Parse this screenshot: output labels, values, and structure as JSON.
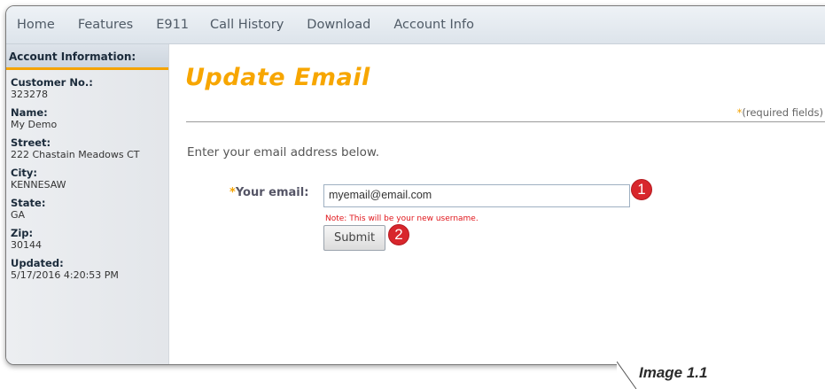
{
  "nav": {
    "items": [
      "Home",
      "Features",
      "E911",
      "Call History",
      "Download",
      "Account Info"
    ]
  },
  "sidebar": {
    "header": "Account Information:",
    "fields": [
      {
        "label": "Customer No.:",
        "value": "323278"
      },
      {
        "label": "Name:",
        "value": "My Demo"
      },
      {
        "label": "Street:",
        "value": "222 Chastain Meadows CT"
      },
      {
        "label": "City:",
        "value": "KENNESAW"
      },
      {
        "label": "State:",
        "value": "GA"
      },
      {
        "label": "Zip:",
        "value": "30144"
      },
      {
        "label": "Updated:",
        "value": "5/17/2016 4:20:53 PM"
      }
    ]
  },
  "main": {
    "title": "Update Email",
    "required_star": "*",
    "required_text": "(required fields)",
    "instruction": "Enter your email address below.",
    "email_star": "*",
    "email_label": "Your email:",
    "email_value": "myemail@email.com",
    "note": "Note: This will be your new username.",
    "submit_label": "Submit"
  },
  "callouts": {
    "badge_1": "1",
    "badge_2": "2"
  },
  "caption": "Image 1.1",
  "colors": {
    "accent": "#f7a600",
    "note_red": "#e0161b",
    "badge_red": "#d8262c"
  }
}
